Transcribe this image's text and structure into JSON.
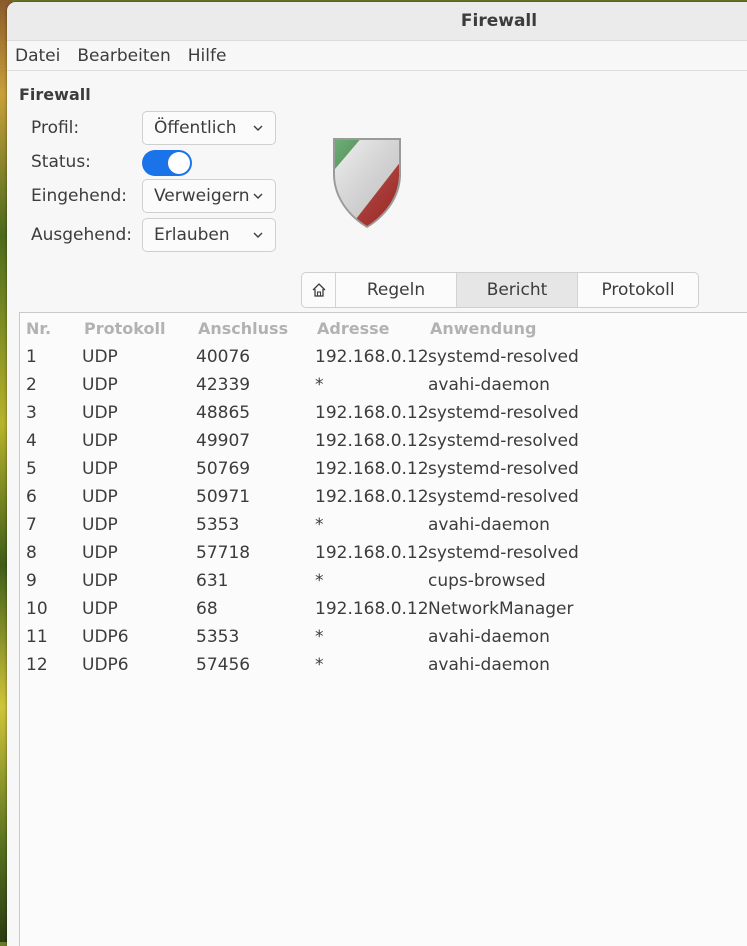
{
  "window": {
    "title": "Firewall"
  },
  "menu": [
    "Datei",
    "Bearbeiten",
    "Hilfe"
  ],
  "section_title": "Firewall",
  "form": {
    "profile_label": "Profil:",
    "profile_value": "Öffentlich",
    "status_label": "Status:",
    "status_on": true,
    "incoming_label": "Eingehend:",
    "incoming_value": "Verweigern",
    "outgoing_label": "Ausgehend:",
    "outgoing_value": "Erlauben"
  },
  "tabs": {
    "home_icon": "home-icon",
    "rules": "Regeln",
    "report": "Bericht",
    "log": "Protokoll",
    "active": "report"
  },
  "report": {
    "columns": [
      "Nr.",
      "Protokoll",
      "Anschluss",
      "Adresse",
      "Anwendung"
    ],
    "rows": [
      [
        "1",
        "UDP",
        "40076",
        "192.168.0.12",
        "systemd-resolved"
      ],
      [
        "2",
        "UDP",
        "42339",
        "*",
        "avahi-daemon"
      ],
      [
        "3",
        "UDP",
        "48865",
        "192.168.0.12",
        "systemd-resolved"
      ],
      [
        "4",
        "UDP",
        "49907",
        "192.168.0.12",
        "systemd-resolved"
      ],
      [
        "5",
        "UDP",
        "50769",
        "192.168.0.12",
        "systemd-resolved"
      ],
      [
        "6",
        "UDP",
        "50971",
        "192.168.0.12",
        "systemd-resolved"
      ],
      [
        "7",
        "UDP",
        "5353",
        "*",
        "avahi-daemon"
      ],
      [
        "8",
        "UDP",
        "57718",
        "192.168.0.12",
        "systemd-resolved"
      ],
      [
        "9",
        "UDP",
        "631",
        "*",
        "cups-browsed"
      ],
      [
        "10",
        "UDP",
        "68",
        "192.168.0.12",
        "NetworkManager"
      ],
      [
        "11",
        "UDP6",
        "5353",
        "*",
        "avahi-daemon"
      ],
      [
        "12",
        "UDP6",
        "57456",
        "*",
        "avahi-daemon"
      ]
    ]
  },
  "colors": {
    "accent": "#1a73e8",
    "shield_green": "#2e8b3a",
    "shield_red": "#c0302b"
  }
}
